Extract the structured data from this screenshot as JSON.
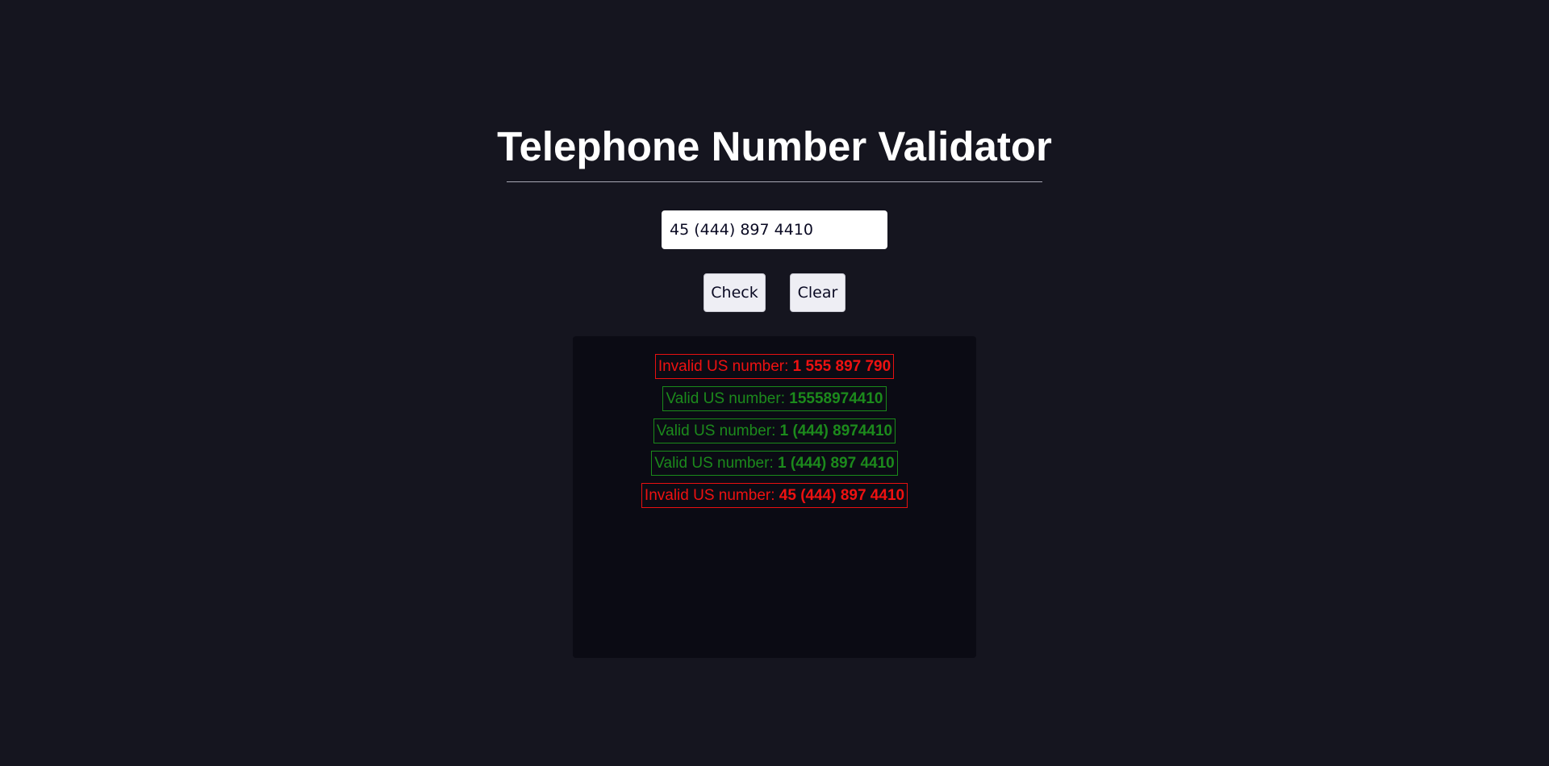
{
  "header": {
    "title": "Telephone Number Validator"
  },
  "input": {
    "value": "45 (444) 897 4410"
  },
  "buttons": {
    "check_label": "Check",
    "clear_label": "Clear"
  },
  "colors": {
    "background": "#15151f",
    "results_background": "#0b0b14",
    "valid": "#1c8a1c",
    "invalid": "#ee1111"
  },
  "results": [
    {
      "status": "invalid",
      "label": "Invalid US number: ",
      "number": "1 555 897 790"
    },
    {
      "status": "valid",
      "label": "Valid US number: ",
      "number": "15558974410"
    },
    {
      "status": "valid",
      "label": "Valid US number: ",
      "number": "1 (444) 8974410"
    },
    {
      "status": "valid",
      "label": "Valid US number: ",
      "number": "1 (444) 897 4410"
    },
    {
      "status": "invalid",
      "label": "Invalid US number: ",
      "number": "45 (444) 897 4410"
    }
  ]
}
